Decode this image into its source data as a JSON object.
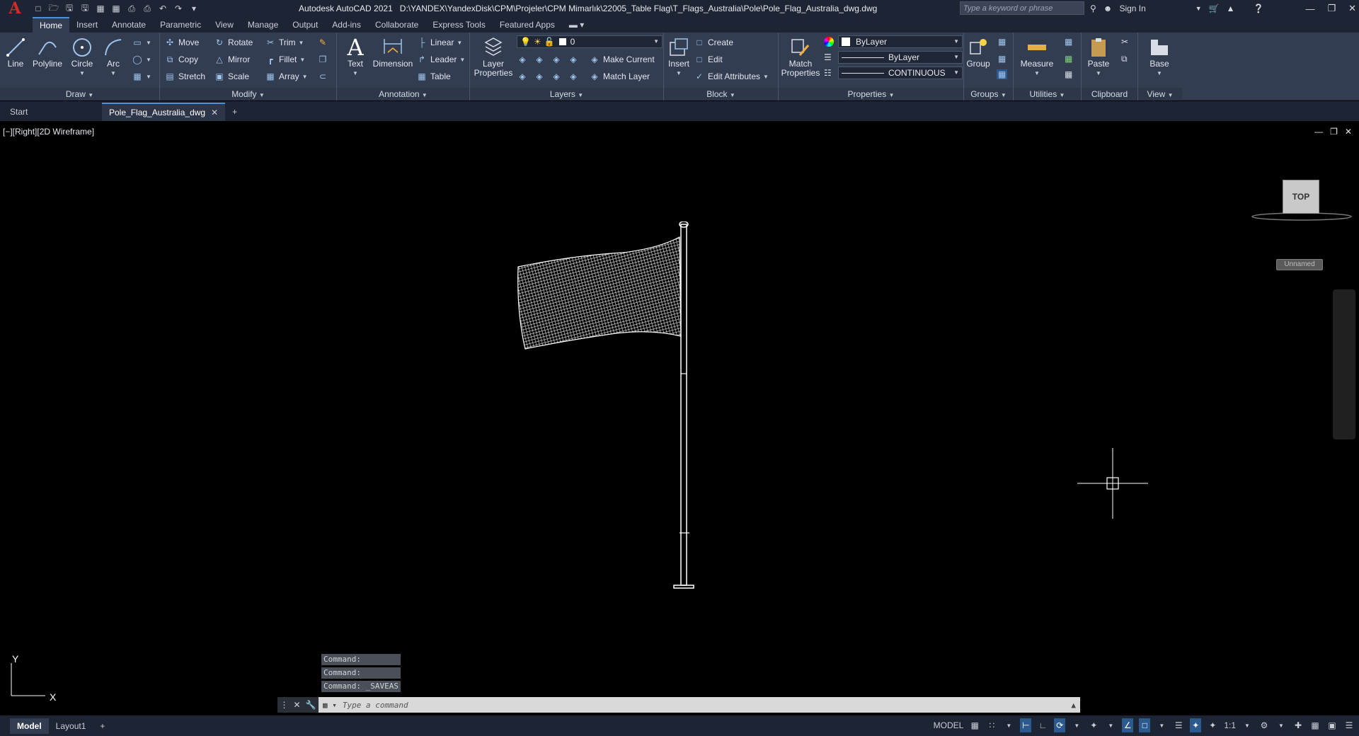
{
  "app": {
    "logo": "A",
    "title": "Autodesk AutoCAD 2021",
    "file_path": "D:\\YANDEX\\YandexDisk\\CPM\\Projeler\\CPM Mimarlık\\22005_Table Flag\\T_Flags_Australia\\Pole\\Pole_Flag_Australia_dwg.dwg",
    "search_placeholder": "Type a keyword or phrase",
    "sign_in": "Sign In"
  },
  "menu_tabs": [
    "Home",
    "Insert",
    "Annotate",
    "Parametric",
    "View",
    "Manage",
    "Output",
    "Add-ins",
    "Collaborate",
    "Express Tools",
    "Featured Apps"
  ],
  "ribbon": {
    "draw": {
      "title": "Draw",
      "line": "Line",
      "polyline": "Polyline",
      "circle": "Circle",
      "arc": "Arc"
    },
    "modify": {
      "title": "Modify",
      "move": "Move",
      "rotate": "Rotate",
      "trim": "Trim",
      "copy": "Copy",
      "mirror": "Mirror",
      "fillet": "Fillet",
      "stretch": "Stretch",
      "scale": "Scale",
      "array": "Array"
    },
    "annotation": {
      "title": "Annotation",
      "text": "Text",
      "dimension": "Dimension",
      "linear": "Linear",
      "leader": "Leader",
      "table": "Table"
    },
    "layers": {
      "title": "Layers",
      "layer_properties": "Layer Properties",
      "current_layer": "0",
      "make_current": "Make Current",
      "match_layer": "Match Layer"
    },
    "block": {
      "title": "Block",
      "insert": "Insert",
      "create": "Create",
      "edit": "Edit",
      "edit_attributes": "Edit Attributes"
    },
    "properties": {
      "title": "Properties",
      "match_properties": "Match Properties",
      "color": "ByLayer",
      "lineweight": "ByLayer",
      "linetype": "CONTINUOUS"
    },
    "groups": {
      "title": "Groups",
      "group": "Group"
    },
    "utilities": {
      "title": "Utilities",
      "measure": "Measure"
    },
    "clipboard": {
      "title": "Clipboard",
      "paste": "Paste"
    },
    "view": {
      "title": "View",
      "base": "Base"
    }
  },
  "doc_tabs": {
    "start": "Start",
    "active": "Pole_Flag_Australia_dwg"
  },
  "viewport": {
    "label": "[−][Right][2D Wireframe]",
    "viewcube": "TOP",
    "ucs_name": "Unnamed",
    "axis_y": "Y",
    "axis_x": "X"
  },
  "command": {
    "history": [
      "Command:",
      "Command:",
      "Command:  _SAVEAS"
    ],
    "placeholder": "Type a command"
  },
  "layout_tabs": [
    "Model",
    "Layout1"
  ],
  "status": {
    "model": "MODEL",
    "scale": "1:1"
  },
  "colors": {
    "accent": "#4a90d9",
    "ribbon_bg": "#333d52",
    "title_bg": "#1d2433",
    "logo": "#d32a2a"
  }
}
